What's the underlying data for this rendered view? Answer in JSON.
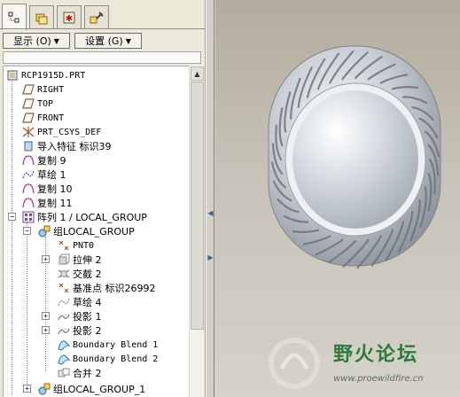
{
  "tabs": [
    {
      "icon": "model-tree-icon",
      "active": true
    },
    {
      "icon": "folder-browser-icon",
      "active": false
    },
    {
      "icon": "favorites-icon",
      "active": false
    },
    {
      "icon": "connections-icon",
      "active": false
    }
  ],
  "toolbar": {
    "show_label": "显示 (O)",
    "settings_label": "设置 (G)"
  },
  "tree": {
    "root": "RCP1915D.PRT",
    "items": [
      {
        "label": "RIGHT",
        "icon": "datum-plane-icon"
      },
      {
        "label": "TOP",
        "icon": "datum-plane-icon"
      },
      {
        "label": "FRONT",
        "icon": "datum-plane-icon"
      },
      {
        "label": "PRT_CSYS_DEF",
        "icon": "coordinate-system-icon"
      },
      {
        "label": "导入特征 标识39",
        "icon": "import-feature-icon"
      },
      {
        "label": "复制 9",
        "icon": "copy-surface-icon"
      },
      {
        "label": "草绘 1",
        "icon": "sketch-icon"
      },
      {
        "label": "复制 10",
        "icon": "copy-surface-icon"
      },
      {
        "label": "复制 11",
        "icon": "copy-surface-icon"
      },
      {
        "label": "阵列 1 / LOCAL_GROUP",
        "icon": "pattern-icon"
      },
      {
        "label": "组LOCAL_GROUP",
        "icon": "group-icon"
      },
      {
        "label": "PNT0",
        "icon": "datum-point-icon"
      },
      {
        "label": "拉伸 2",
        "icon": "extrude-icon"
      },
      {
        "label": "交截 2",
        "icon": "intersect-icon"
      },
      {
        "label": "基准点 标识26992",
        "icon": "datum-point-icon"
      },
      {
        "label": "草绘 4",
        "icon": "sketch-icon"
      },
      {
        "label": "投影 1",
        "icon": "project-icon"
      },
      {
        "label": "投影 2",
        "icon": "project-icon"
      },
      {
        "label": "Boundary Blend 1",
        "icon": "boundary-blend-icon"
      },
      {
        "label": "Boundary Blend 2",
        "icon": "boundary-blend-icon"
      },
      {
        "label": "合并 2",
        "icon": "merge-icon"
      },
      {
        "label": "组LOCAL_GROUP_1",
        "icon": "group-icon"
      }
    ]
  },
  "watermark": {
    "title": "野火论坛",
    "url": "www.proewildfire.cn"
  },
  "colors": {
    "panel_bg": "#ece9d8",
    "viewport_bg": "#c8c3b8",
    "accent_green": "#2f7a3a",
    "model_silver": "#c8ccd2"
  }
}
